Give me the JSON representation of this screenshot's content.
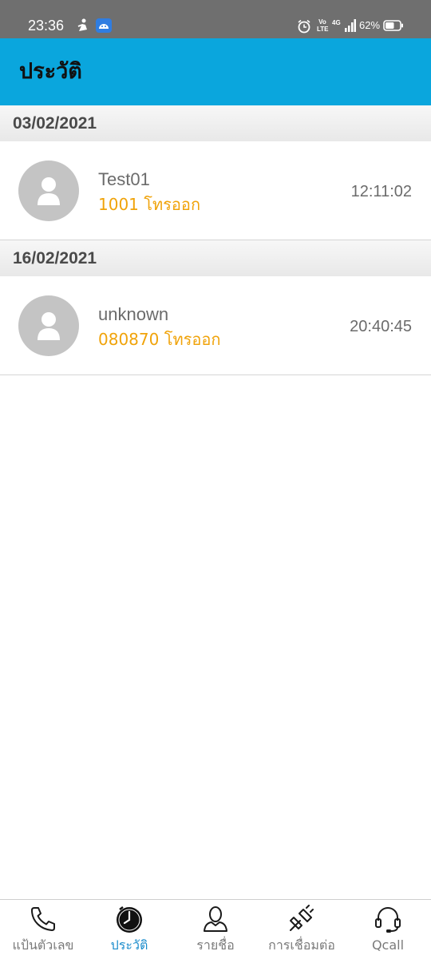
{
  "status_bar": {
    "time": "23:36",
    "volte_top": "Vo",
    "volte_bottom": "LTE",
    "network": "4G",
    "battery_percent": "62%",
    "battery_level": 0.62
  },
  "header": {
    "title": "ประวัติ",
    "background": "#0aa6dd"
  },
  "history": [
    {
      "date": "03/02/2021",
      "calls": [
        {
          "name": "Test01",
          "detail": "1001 โทรออก",
          "time": "12:11:02"
        }
      ]
    },
    {
      "date": "16/02/2021",
      "calls": [
        {
          "name": "unknown",
          "detail": "080870 โทรออก",
          "time": "20:40:45"
        }
      ]
    }
  ],
  "bottom_nav": {
    "items": [
      {
        "label": "แป้นตัวเลข",
        "icon": "phone-icon",
        "active": false
      },
      {
        "label": "ประวัติ",
        "icon": "clock-icon",
        "active": true
      },
      {
        "label": "รายชื่อ",
        "icon": "person-icon",
        "active": false
      },
      {
        "label": "การเชื่อมต่อ",
        "icon": "plug-icon",
        "active": false
      },
      {
        "label": "Qcall",
        "icon": "headset-icon",
        "active": false
      }
    ],
    "active_color": "#1a8ccc",
    "inactive_color": "#7a7a7a"
  },
  "colors": {
    "accent": "#0aa6dd",
    "call_detail": "#f0a30a",
    "text_muted": "#6b6b6b"
  }
}
